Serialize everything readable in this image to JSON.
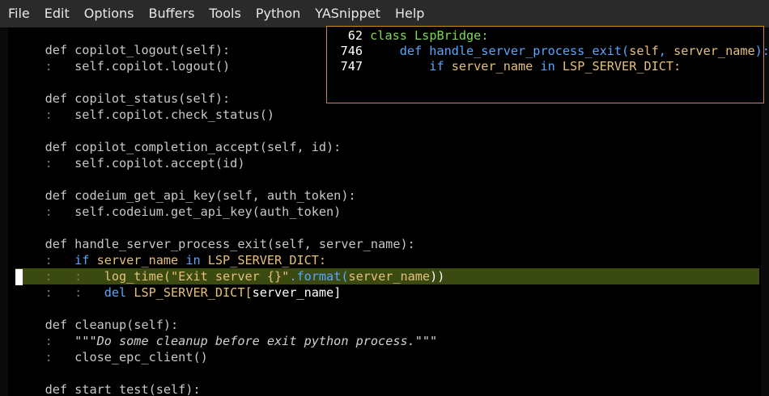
{
  "menubar": {
    "items": [
      "File",
      "Edit",
      "Options",
      "Buffers",
      "Tools",
      "Python",
      "YASnippet",
      "Help"
    ]
  },
  "editor": {
    "lines": [
      {
        "guide": "",
        "segments": [
          {
            "t": "def copilot_logout(self):",
            "c": "muted"
          }
        ]
      },
      {
        "guide": ":   ",
        "segments": [
          {
            "t": "self.copilot.logout()",
            "c": "muted"
          }
        ]
      },
      {
        "guide": "",
        "segments": []
      },
      {
        "guide": "",
        "segments": [
          {
            "t": "def copilot_status(self):",
            "c": "muted"
          }
        ]
      },
      {
        "guide": ":   ",
        "segments": [
          {
            "t": "self.copilot.check_status()",
            "c": "muted"
          }
        ]
      },
      {
        "guide": "",
        "segments": []
      },
      {
        "guide": "",
        "segments": [
          {
            "t": "def copilot_completion_accept(self, id):",
            "c": "muted"
          }
        ]
      },
      {
        "guide": ":   ",
        "segments": [
          {
            "t": "self.copilot.accept(id)",
            "c": "muted"
          }
        ]
      },
      {
        "guide": "",
        "segments": []
      },
      {
        "guide": "",
        "segments": [
          {
            "t": "def codeium_get_api_key(self, auth_token):",
            "c": "muted"
          }
        ]
      },
      {
        "guide": ":   ",
        "segments": [
          {
            "t": "self.codeium.get_api_key(auth_token)",
            "c": "muted"
          }
        ]
      },
      {
        "guide": "",
        "segments": []
      },
      {
        "guide": "",
        "segments": [
          {
            "t": "def handle_server_process_exit(self, server_name):",
            "c": "muted"
          }
        ]
      },
      {
        "guide": ":   ",
        "segments": [
          {
            "t": "if ",
            "c": "kw"
          },
          {
            "t": "server_name ",
            "c": "str"
          },
          {
            "t": "in ",
            "c": "kw"
          },
          {
            "t": "LSP_SERVER_DICT:",
            "c": "str"
          }
        ]
      },
      {
        "guide": ":   :   ",
        "current": true,
        "segments": [
          {
            "t": "log_time(",
            "c": "str"
          },
          {
            "t": "\"Exit server {}\"",
            "c": "str"
          },
          {
            "t": ".format(",
            "c": "kw"
          },
          {
            "t": "server_name",
            "c": "str"
          },
          {
            "t": "))",
            "c": "fn-red"
          }
        ]
      },
      {
        "guide": ":   :   ",
        "segments": [
          {
            "t": "del ",
            "c": "kw"
          },
          {
            "t": "LSP_SERVER_DICT[",
            "c": "str"
          },
          {
            "t": "server_name",
            "c": "fn-red"
          },
          {
            "t": "]",
            "c": "fn-red"
          }
        ]
      },
      {
        "guide": "",
        "segments": []
      },
      {
        "guide": "",
        "segments": [
          {
            "t": "def cleanup(self):",
            "c": "muted"
          }
        ]
      },
      {
        "guide": ":   ",
        "segments": [
          {
            "t": "\"\"\"Do some cleanup before exit python process.\"\"\"",
            "c": "doc"
          }
        ]
      },
      {
        "guide": ":   ",
        "segments": [
          {
            "t": "close_epc_client()",
            "c": "muted"
          }
        ]
      },
      {
        "guide": "",
        "segments": []
      },
      {
        "guide": "",
        "segments": [
          {
            "t": "def start_test(self):",
            "c": "muted"
          }
        ]
      }
    ]
  },
  "popup": {
    "lines": [
      {
        "num": "62",
        "indent": "",
        "segments": [
          {
            "t": "class ",
            "c": "pcls"
          },
          {
            "t": "LspBridge:",
            "c": "pcls"
          }
        ]
      },
      {
        "num": "746",
        "indent": "    ",
        "segments": [
          {
            "t": "def ",
            "c": "pkw"
          },
          {
            "t": "handle_server_process_exit(",
            "c": "pkw"
          },
          {
            "t": "self",
            "c": "pself"
          },
          {
            "t": ", ",
            "c": "pkw"
          },
          {
            "t": "server_name",
            "c": "pself"
          },
          {
            "t": "):",
            "c": "pkw"
          }
        ]
      },
      {
        "num": "747",
        "indent": "        ",
        "segments": [
          {
            "t": "if ",
            "c": "pkw"
          },
          {
            "t": "server_name ",
            "c": "pself"
          },
          {
            "t": "in ",
            "c": "pkw"
          },
          {
            "t": "LSP_SERVER_DICT:",
            "c": "pself"
          }
        ]
      }
    ]
  },
  "colors": {
    "menubar_bg": "#2a2a2a",
    "current_line_bg": "#3a4a10",
    "popup_border": "#d08a1c",
    "keyword": "#58a6ff",
    "name_yellow": "#e5c07b",
    "class_green": "#7ed957"
  }
}
